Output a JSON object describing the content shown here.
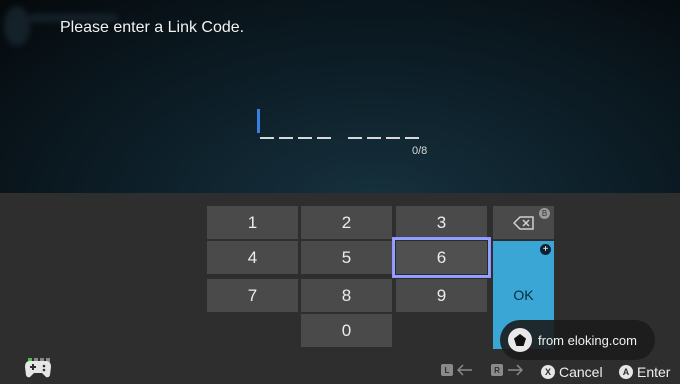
{
  "header": {
    "prompt": "Please enter a Link Code."
  },
  "code_input": {
    "counter": "0/8"
  },
  "keypad": {
    "keys": [
      "1",
      "2",
      "3",
      "4",
      "5",
      "6",
      "7",
      "8",
      "9",
      "0"
    ],
    "selected_key": "6",
    "backspace_badge": "B",
    "ok_label": "OK",
    "plus_badge": "+"
  },
  "footer": {
    "l_button": "L",
    "r_button": "R",
    "cancel_button": "X",
    "cancel_label": "Cancel",
    "enter_button": "A",
    "enter_label": "Enter"
  },
  "watermark": {
    "text": "from eloking.com"
  },
  "colors": {
    "ok_key": "#3aa6d6",
    "caret": "#3b7fe0",
    "selection_border": "#8aa7ff"
  }
}
